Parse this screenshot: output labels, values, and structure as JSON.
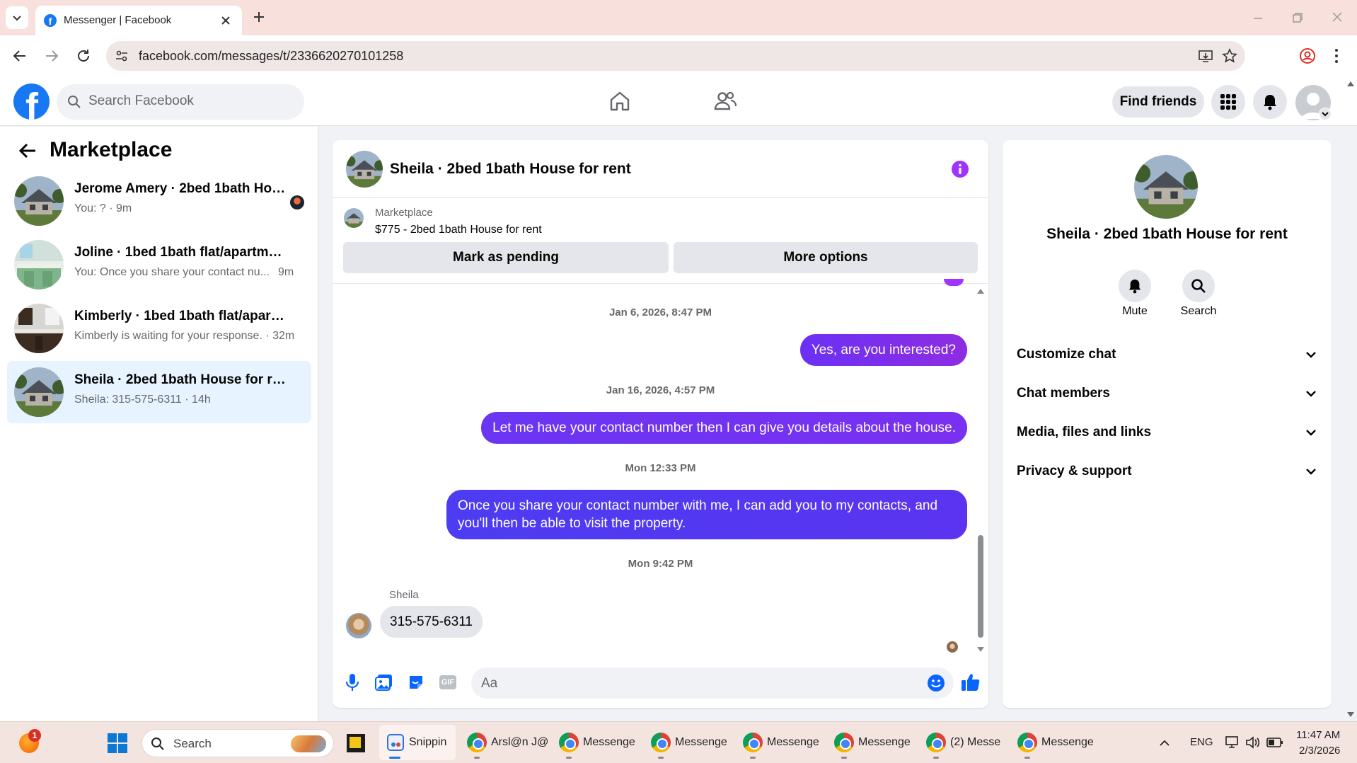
{
  "browser": {
    "tab_title": "Messenger | Facebook",
    "url": "facebook.com/messages/t/2336620270101258"
  },
  "fb": {
    "search_placeholder": "Search Facebook",
    "find_friends": "Find friends"
  },
  "sidebar": {
    "title": "Marketplace",
    "conversations": [
      {
        "title": "Jerome Amery · 2bed 1bath Hou...",
        "subtitle": "You: ? · 9m"
      },
      {
        "title": "Joline · 1bed 1bath flat/apartment",
        "subtitle": "You: Once you share your contact nu...",
        "time": "9m"
      },
      {
        "title": "Kimberly · 1bed 1bath flat/apartme...",
        "subtitle": "Kimberly is waiting for your response. · 32m"
      },
      {
        "title": "Sheila · 2bed 1bath House for rent",
        "subtitle": "Sheila: 315-575-6311 · 14h"
      }
    ]
  },
  "chat": {
    "header_title": "Sheila · 2bed 1bath House for rent",
    "listing_source": "Marketplace",
    "listing_title": "$775 - 2bed 1bath House for rent",
    "mark_pending": "Mark as pending",
    "more_options": "More options",
    "messages": [
      {
        "type": "timestamp",
        "text": "Jan 6, 2026, 8:47 PM"
      },
      {
        "type": "out",
        "text": "Yes, are you interested?"
      },
      {
        "type": "timestamp",
        "text": "Jan 16, 2026, 4:57 PM"
      },
      {
        "type": "out",
        "text": "Let me have your contact number then I can give you details about the house."
      },
      {
        "type": "timestamp",
        "text": "Mon 12:33 PM"
      },
      {
        "type": "out",
        "text": "Once you share your contact number with me, I can add you to my contacts, and you'll then be able to visit the property."
      },
      {
        "type": "timestamp",
        "text": "Mon 9:42 PM"
      },
      {
        "type": "sender",
        "text": "Sheila"
      },
      {
        "type": "in",
        "text": "315-575-6311"
      }
    ],
    "composer_placeholder": "Aa",
    "gif_label": "GIF"
  },
  "info": {
    "title": "Sheila · 2bed 1bath House for rent",
    "mute_label": "Mute",
    "search_label": "Search",
    "sections": [
      "Customize chat",
      "Chat members",
      "Media, files and links",
      "Privacy & support"
    ]
  },
  "taskbar": {
    "badge": "1",
    "search_placeholder": "Search",
    "apps": [
      "Snippin",
      "Arsl@n J@",
      "Messenge",
      "Messenge",
      "Messenge",
      "Messenge",
      "(2) Messe",
      "Messenge"
    ],
    "lang": "ENG",
    "time": "11:47 AM",
    "date": "2/3/2026"
  },
  "colors": {
    "fb_blue": "#1877f2",
    "messenger_purple": "#8e2de2",
    "active_conv": "#e7f3ff"
  }
}
